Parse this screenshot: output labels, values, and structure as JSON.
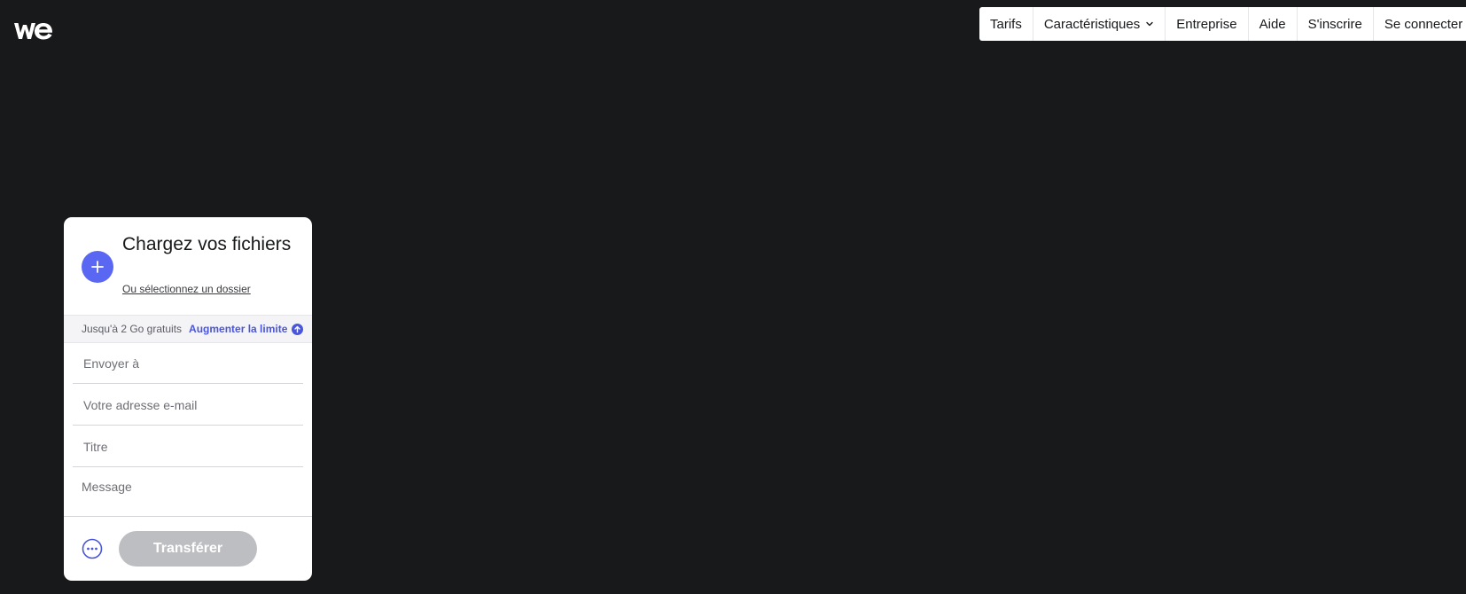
{
  "brand": {
    "logo_icon": "wetransfer-logo-icon",
    "logo_color": "#ffffff"
  },
  "nav": {
    "items": [
      {
        "label": "Tarifs"
      },
      {
        "label": "Caractéristiques",
        "icon": "chevron-down-icon"
      },
      {
        "label": "Entreprise"
      },
      {
        "label": "Aide"
      },
      {
        "label": "S'inscrire"
      },
      {
        "label": "Se connecter"
      }
    ]
  },
  "upload": {
    "title": "Chargez vos fichiers",
    "folder_link": "Ou sélectionnez un dossier",
    "add_icon": "plus-icon",
    "accent_color": "#5a67f2"
  },
  "limit": {
    "text": "Jusqu'à 2 Go gratuits",
    "link": "Augmenter la limite",
    "link_icon": "arrow-up-circle-icon"
  },
  "form": {
    "send_to_placeholder": "Envoyer à",
    "email_placeholder": "Votre adresse e-mail",
    "title_placeholder": "Titre",
    "message_placeholder": "Message"
  },
  "actions": {
    "more_icon": "more-options-icon",
    "transfer_label": "Transférer"
  }
}
